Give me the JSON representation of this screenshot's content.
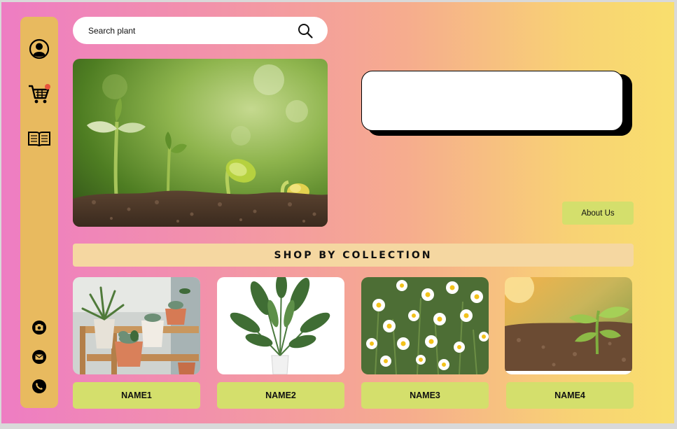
{
  "sidebar": {
    "top_icons": [
      "profile-icon",
      "cart-icon",
      "book-icon"
    ],
    "bottom_icons": [
      "camera-icon",
      "mail-icon",
      "phone-icon"
    ],
    "cart_badge_color": "#e8543c"
  },
  "search": {
    "placeholder": "Search plant",
    "icon": "search-icon"
  },
  "hero": {
    "image": "seedlings-growing-photo"
  },
  "about": {
    "label": "About Us"
  },
  "collection": {
    "title": "SHOP BY COLLECTION",
    "cards": [
      {
        "name": "NAME1",
        "image": "potted-succulents-photo"
      },
      {
        "name": "NAME2",
        "image": "potted-plant-photo"
      },
      {
        "name": "NAME3",
        "image": "daisies-photo"
      },
      {
        "name": "NAME4",
        "image": "sprout-in-soil-photo"
      }
    ]
  },
  "colors": {
    "sidebar": "#e8ba5f",
    "button": "#d4df6c",
    "collection_bar": "#f5d7a1",
    "gradient_start": "#ee7dc3",
    "gradient_end": "#f9df6d"
  }
}
